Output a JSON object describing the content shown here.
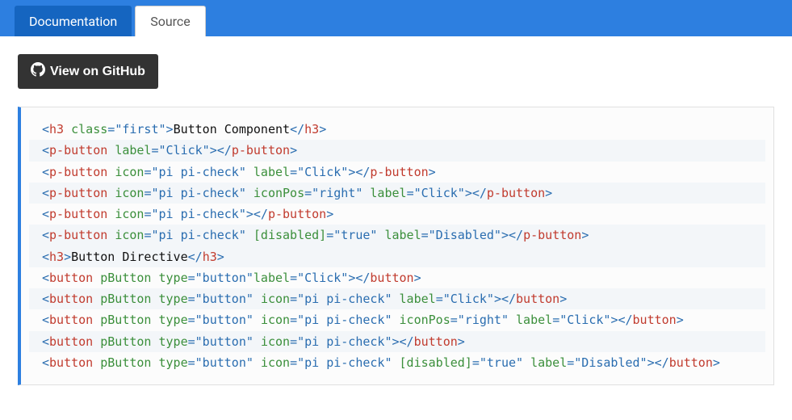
{
  "tabs": {
    "documentation": "Documentation",
    "source": "Source"
  },
  "github_button": "View on GitHub",
  "code": {
    "lines": [
      [
        [
          "p",
          "<"
        ],
        [
          "t",
          "h3"
        ],
        [
          "x",
          " "
        ],
        [
          "a",
          "class"
        ],
        [
          "p",
          "="
        ],
        [
          "v",
          "\"first\""
        ],
        [
          "p",
          ">"
        ],
        [
          "x",
          "Button Component"
        ],
        [
          "p",
          "</"
        ],
        [
          "t",
          "h3"
        ],
        [
          "p",
          ">"
        ]
      ],
      [
        [
          "p",
          "<"
        ],
        [
          "t",
          "p-button"
        ],
        [
          "x",
          " "
        ],
        [
          "a",
          "label"
        ],
        [
          "p",
          "="
        ],
        [
          "v",
          "\"Click\""
        ],
        [
          "p",
          ">"
        ],
        [
          "p",
          "</"
        ],
        [
          "t",
          "p-button"
        ],
        [
          "p",
          ">"
        ]
      ],
      [
        [
          "p",
          "<"
        ],
        [
          "t",
          "p-button"
        ],
        [
          "x",
          " "
        ],
        [
          "a",
          "icon"
        ],
        [
          "p",
          "="
        ],
        [
          "v",
          "\"pi pi-check\""
        ],
        [
          "x",
          " "
        ],
        [
          "a",
          "label"
        ],
        [
          "p",
          "="
        ],
        [
          "v",
          "\"Click\""
        ],
        [
          "p",
          ">"
        ],
        [
          "p",
          "</"
        ],
        [
          "t",
          "p-button"
        ],
        [
          "p",
          ">"
        ]
      ],
      [
        [
          "p",
          "<"
        ],
        [
          "t",
          "p-button"
        ],
        [
          "x",
          " "
        ],
        [
          "a",
          "icon"
        ],
        [
          "p",
          "="
        ],
        [
          "v",
          "\"pi pi-check\""
        ],
        [
          "x",
          " "
        ],
        [
          "a",
          "iconPos"
        ],
        [
          "p",
          "="
        ],
        [
          "v",
          "\"right\""
        ],
        [
          "x",
          " "
        ],
        [
          "a",
          "label"
        ],
        [
          "p",
          "="
        ],
        [
          "v",
          "\"Click\""
        ],
        [
          "p",
          ">"
        ],
        [
          "p",
          "</"
        ],
        [
          "t",
          "p-button"
        ],
        [
          "p",
          ">"
        ]
      ],
      [
        [
          "p",
          "<"
        ],
        [
          "t",
          "p-button"
        ],
        [
          "x",
          " "
        ],
        [
          "a",
          "icon"
        ],
        [
          "p",
          "="
        ],
        [
          "v",
          "\"pi pi-check\""
        ],
        [
          "p",
          ">"
        ],
        [
          "p",
          "</"
        ],
        [
          "t",
          "p-button"
        ],
        [
          "p",
          ">"
        ]
      ],
      [
        [
          "p",
          "<"
        ],
        [
          "t",
          "p-button"
        ],
        [
          "x",
          " "
        ],
        [
          "a",
          "icon"
        ],
        [
          "p",
          "="
        ],
        [
          "v",
          "\"pi pi-check\""
        ],
        [
          "x",
          " "
        ],
        [
          "a",
          "[disabled]"
        ],
        [
          "p",
          "="
        ],
        [
          "v",
          "\"true\""
        ],
        [
          "x",
          " "
        ],
        [
          "a",
          "label"
        ],
        [
          "p",
          "="
        ],
        [
          "v",
          "\"Disabled\""
        ],
        [
          "p",
          ">"
        ],
        [
          "p",
          "</"
        ],
        [
          "t",
          "p-button"
        ],
        [
          "p",
          ">"
        ]
      ],
      [
        [
          "x",
          ""
        ]
      ],
      [
        [
          "p",
          "<"
        ],
        [
          "t",
          "h3"
        ],
        [
          "p",
          ">"
        ],
        [
          "x",
          "Button Directive"
        ],
        [
          "p",
          "</"
        ],
        [
          "t",
          "h3"
        ],
        [
          "p",
          ">"
        ]
      ],
      [
        [
          "p",
          "<"
        ],
        [
          "t",
          "button"
        ],
        [
          "x",
          " "
        ],
        [
          "a",
          "pButton"
        ],
        [
          "x",
          " "
        ],
        [
          "a",
          "type"
        ],
        [
          "p",
          "="
        ],
        [
          "v",
          "\"button\""
        ],
        [
          "a",
          "label"
        ],
        [
          "p",
          "="
        ],
        [
          "v",
          "\"Click\""
        ],
        [
          "p",
          ">"
        ],
        [
          "p",
          "</"
        ],
        [
          "t",
          "button"
        ],
        [
          "p",
          ">"
        ]
      ],
      [
        [
          "p",
          "<"
        ],
        [
          "t",
          "button"
        ],
        [
          "x",
          " "
        ],
        [
          "a",
          "pButton"
        ],
        [
          "x",
          " "
        ],
        [
          "a",
          "type"
        ],
        [
          "p",
          "="
        ],
        [
          "v",
          "\"button\""
        ],
        [
          "x",
          " "
        ],
        [
          "a",
          "icon"
        ],
        [
          "p",
          "="
        ],
        [
          "v",
          "\"pi pi-check\""
        ],
        [
          "x",
          " "
        ],
        [
          "a",
          "label"
        ],
        [
          "p",
          "="
        ],
        [
          "v",
          "\"Click\""
        ],
        [
          "p",
          ">"
        ],
        [
          "p",
          "</"
        ],
        [
          "t",
          "button"
        ],
        [
          "p",
          ">"
        ]
      ],
      [
        [
          "p",
          "<"
        ],
        [
          "t",
          "button"
        ],
        [
          "x",
          " "
        ],
        [
          "a",
          "pButton"
        ],
        [
          "x",
          " "
        ],
        [
          "a",
          "type"
        ],
        [
          "p",
          "="
        ],
        [
          "v",
          "\"button\""
        ],
        [
          "x",
          " "
        ],
        [
          "a",
          "icon"
        ],
        [
          "p",
          "="
        ],
        [
          "v",
          "\"pi pi-check\""
        ],
        [
          "x",
          " "
        ],
        [
          "a",
          "iconPos"
        ],
        [
          "p",
          "="
        ],
        [
          "v",
          "\"right\""
        ],
        [
          "x",
          " "
        ],
        [
          "a",
          "label"
        ],
        [
          "p",
          "="
        ],
        [
          "v",
          "\"Click\""
        ],
        [
          "p",
          ">"
        ],
        [
          "p",
          "</"
        ],
        [
          "t",
          "button"
        ],
        [
          "p",
          ">"
        ]
      ],
      [
        [
          "p",
          "<"
        ],
        [
          "t",
          "button"
        ],
        [
          "x",
          " "
        ],
        [
          "a",
          "pButton"
        ],
        [
          "x",
          " "
        ],
        [
          "a",
          "type"
        ],
        [
          "p",
          "="
        ],
        [
          "v",
          "\"button\""
        ],
        [
          "x",
          " "
        ],
        [
          "a",
          "icon"
        ],
        [
          "p",
          "="
        ],
        [
          "v",
          "\"pi pi-check\""
        ],
        [
          "p",
          ">"
        ],
        [
          "p",
          "</"
        ],
        [
          "t",
          "button"
        ],
        [
          "p",
          ">"
        ]
      ],
      [
        [
          "p",
          "<"
        ],
        [
          "t",
          "button"
        ],
        [
          "x",
          " "
        ],
        [
          "a",
          "pButton"
        ],
        [
          "x",
          " "
        ],
        [
          "a",
          "type"
        ],
        [
          "p",
          "="
        ],
        [
          "v",
          "\"button\""
        ],
        [
          "x",
          " "
        ],
        [
          "a",
          "icon"
        ],
        [
          "p",
          "="
        ],
        [
          "v",
          "\"pi pi-check\""
        ],
        [
          "x",
          " "
        ],
        [
          "a",
          "[disabled]"
        ],
        [
          "p",
          "="
        ],
        [
          "v",
          "\"true\""
        ],
        [
          "x",
          " "
        ],
        [
          "a",
          "label"
        ],
        [
          "p",
          "="
        ],
        [
          "v",
          "\"Disabled\""
        ],
        [
          "p",
          ">"
        ],
        [
          "p",
          "</"
        ],
        [
          "t",
          "button"
        ],
        [
          "p",
          ">"
        ]
      ]
    ]
  }
}
